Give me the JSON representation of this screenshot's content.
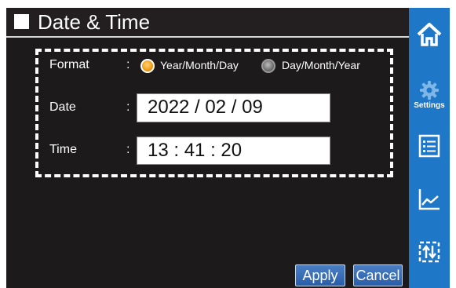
{
  "header": {
    "title": "Date & Time"
  },
  "sidebar": {
    "items": [
      {
        "icon": "home-icon",
        "label": ""
      },
      {
        "icon": "gear-icon",
        "label": "Settings"
      },
      {
        "icon": "list-icon",
        "label": ""
      },
      {
        "icon": "line-chart-icon",
        "label": ""
      },
      {
        "icon": "transfer-icon",
        "label": ""
      }
    ],
    "active_color": "#1f77c8"
  },
  "form": {
    "format_label": "Format",
    "date_label": "Date",
    "time_label": "Time",
    "separator": ":",
    "format_options": [
      {
        "label": "Year/Month/Day",
        "selected": true
      },
      {
        "label": "Day/Month/Year",
        "selected": false
      }
    ],
    "date_value": "2022 / 02 / 09",
    "time_value": "13 : 41 : 20"
  },
  "buttons": {
    "apply": "Apply",
    "cancel": "Cancel"
  }
}
